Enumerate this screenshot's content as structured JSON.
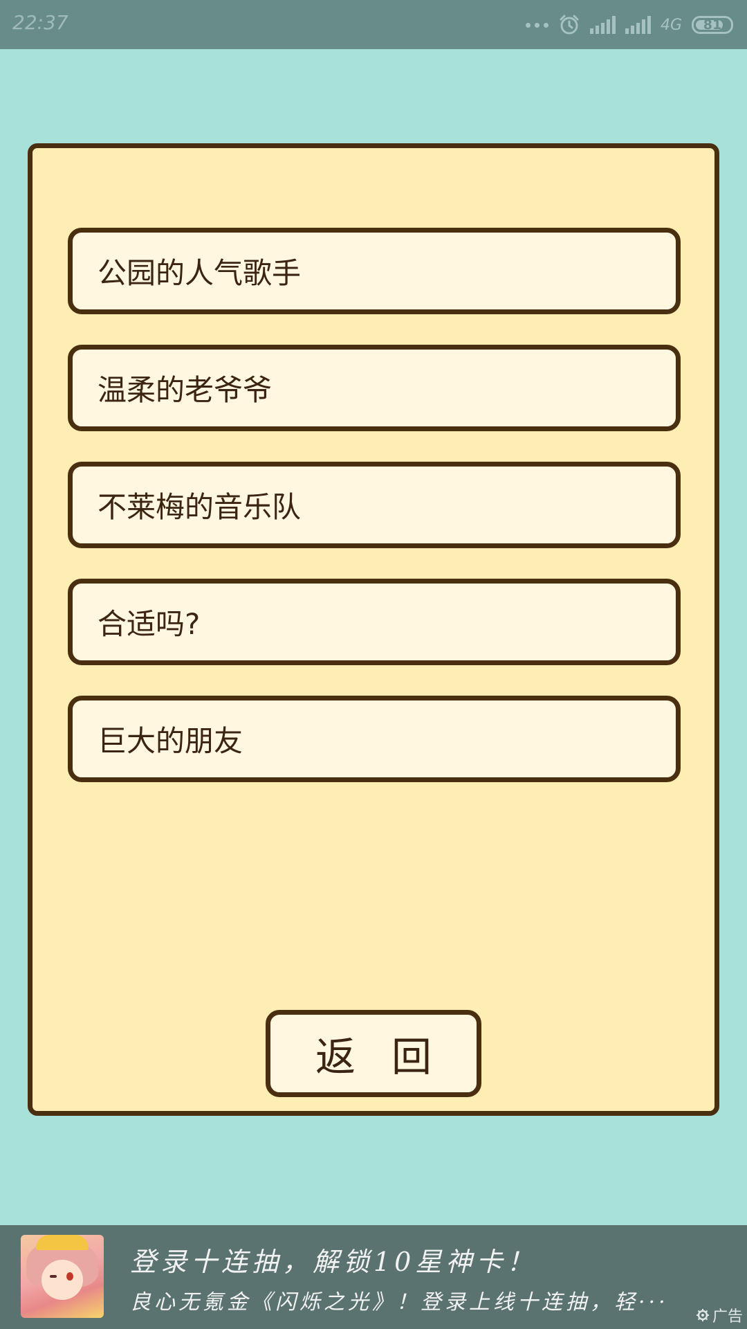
{
  "status_bar": {
    "time": "22:37",
    "network": "4G",
    "battery": "81",
    "icons": [
      "more-dots-icon",
      "alarm-icon",
      "signal-icon",
      "signal-icon"
    ]
  },
  "options": [
    {
      "label": "公园的人气歌手"
    },
    {
      "label": "温柔的老爷爷"
    },
    {
      "label": "不莱梅的音乐队"
    },
    {
      "label": "合适吗?"
    },
    {
      "label": "巨大的朋友"
    }
  ],
  "back_button": {
    "label": "返回"
  },
  "ad": {
    "title": "登录十连抽，解锁10星神卡！",
    "description": "良心无氪金《闪烁之光》！登录上线十连抽，轻···",
    "label": "广告",
    "icon": "settings-gear-icon"
  },
  "colors": {
    "background": "#a8e0da",
    "panel": "#ffeeb4",
    "option_fill": "#fff7e0",
    "border": "#4a2e10",
    "status_bar": "#678c8a",
    "ad_bar": "#5a7370"
  }
}
